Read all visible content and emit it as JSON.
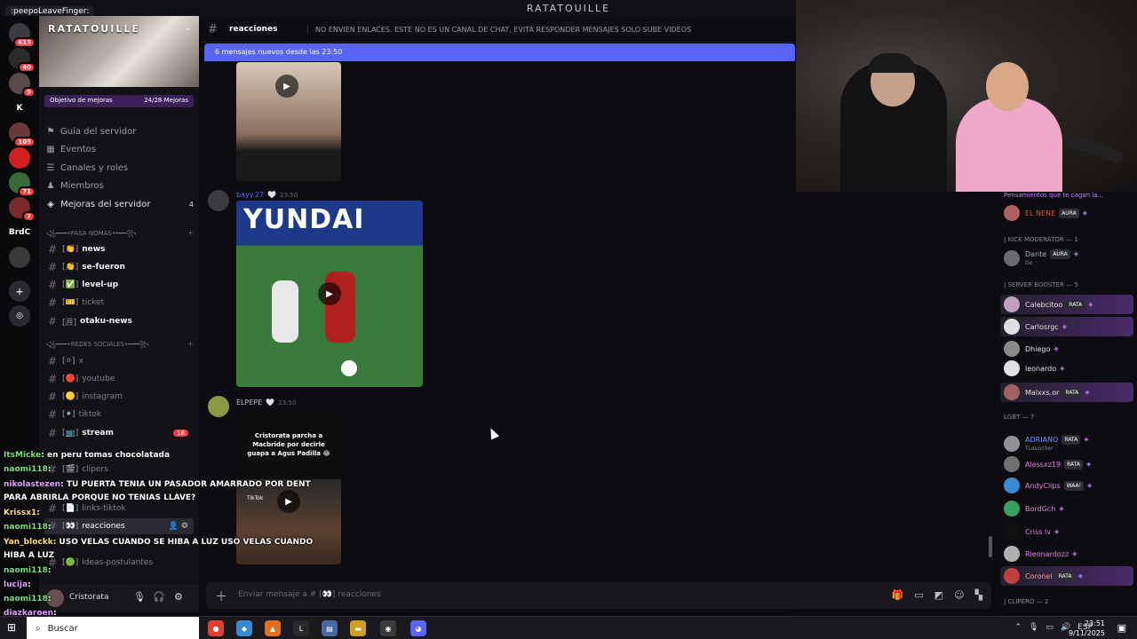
{
  "window": {
    "title": "RATATOUILLE",
    "tag": ":peepoLeaveFinger:"
  },
  "rail": {
    "servers": [
      {
        "label": "",
        "badge": "615",
        "color": "#3a3a40"
      },
      {
        "label": "",
        "badge": "40",
        "color": "#2a2a2a"
      },
      {
        "label": "",
        "badge": "9",
        "color": "#5a4a4a"
      },
      {
        "label": "K",
        "badge": "",
        "color": "#0a0a0d"
      },
      {
        "label": "",
        "badge": "105",
        "color": "#6a3a3a"
      },
      {
        "label": "",
        "badge": "",
        "color": "#d02020"
      },
      {
        "label": "",
        "badge": "71",
        "color": "#3a6a3a"
      },
      {
        "label": "",
        "badge": "7",
        "color": "#7a2a2a"
      },
      {
        "label": "BrdC",
        "badge": "",
        "color": "#0a0a0d"
      },
      {
        "label": "",
        "badge": "",
        "color": "#3a3a3a"
      }
    ],
    "add_icon": "plus-icon",
    "discover_icon": "compass-icon"
  },
  "server": {
    "name": "RATATOUILLE",
    "goal_label": "Objetivo de mejoras",
    "goal_value": "24/28 Mejoras",
    "nav": [
      {
        "label": "Guía del servidor",
        "icon": "signpost-icon",
        "glyph": "⚑"
      },
      {
        "label": "Eventos",
        "icon": "calendar-icon",
        "glyph": "▦"
      },
      {
        "label": "Canales y roles",
        "icon": "list-icon",
        "glyph": "☰"
      },
      {
        "label": "Miembros",
        "icon": "members-icon",
        "glyph": "♟"
      },
      {
        "label": "Mejoras del servidor",
        "icon": "boost-icon",
        "glyph": "◈",
        "count": "4"
      }
    ],
    "categories": [
      {
        "label": "꧁━━━•PASA NOMAS•━━━꧂"
      },
      {
        "label": "꧁━━━•REDES SOCIALES•━━━꧂"
      }
    ],
    "channels": [
      {
        "emoji": "[👏]",
        "name": "news",
        "bold": true
      },
      {
        "emoji": "[👏]",
        "name": "se-fueron",
        "bold": true
      },
      {
        "emoji": "[✅]",
        "name": "level-up",
        "bold": true
      },
      {
        "emoji": "[🎫]",
        "name": "ticket",
        "bold": false
      },
      {
        "emoji": "[🈷]",
        "name": "otaku-news",
        "bold": true
      },
      {
        "emoji": "[⚪]",
        "name": "x",
        "bold": false
      },
      {
        "emoji": "[🔴]",
        "name": "youtube",
        "bold": false
      },
      {
        "emoji": "[🟡]",
        "name": "instagram",
        "bold": false
      },
      {
        "emoji": "[⚫]",
        "name": "tiktok",
        "bold": false
      },
      {
        "emoji": "[📺]",
        "name": "stream",
        "bold": true,
        "pill": "16"
      },
      {
        "emoji": "[🎬]",
        "name": "clipers",
        "bold": false
      },
      {
        "emoji": "[📄]",
        "name": "links-tiktok",
        "bold": false
      },
      {
        "emoji": "[👀]",
        "name": "reacciones",
        "bold": false,
        "active": true
      },
      {
        "emoji": "[🟢]",
        "name": "ideas-postulantes",
        "bold": false
      }
    ],
    "user": {
      "name": "Cristorata"
    }
  },
  "streamchat": [
    {
      "user": "ItsMicke",
      "text": ": en peru tomas chocolatada",
      "cls": "g"
    },
    {
      "user": "naomi118",
      "text": ":",
      "cls": "g"
    },
    {
      "user": "nikolastezen",
      "text": ": TU PUERTA TENIA UN PASADOR AMARRADO POR DENT",
      "cls": "p"
    },
    {
      "user": "",
      "text": "PARA ABRIRLA PORQUE NO TENIAS LLAVE?",
      "cls": ""
    },
    {
      "user": "Krissx1",
      "text": ":",
      "cls": "y"
    },
    {
      "user": "naomi118",
      "text": ":",
      "cls": "g"
    },
    {
      "user": "Yan_blockk",
      "text": ": USO VELAS CUANDO SE HIBA A LUZ USO VELAS CUANDO",
      "cls": "y"
    },
    {
      "user": "",
      "text": "HIBA A LUZ",
      "cls": ""
    },
    {
      "user": "naomi118",
      "text": ":",
      "cls": "g"
    },
    {
      "user": "lucija",
      "text": ":",
      "cls": "p"
    },
    {
      "user": "naomi118",
      "text": ":",
      "cls": "g"
    },
    {
      "user": "diazkaroen",
      "text": ":",
      "cls": "p"
    }
  ],
  "channel": {
    "name": "reacciones",
    "topic": "NO ENVIEN ENLACES. ESTE NO ES UN CANAL DE CHAT, EVITA RESPONDER MENSAJES SOLO SUBE VIDEOS",
    "new_messages": "6 mensajes nuevos desde las 23:50"
  },
  "messages": [
    {
      "author": "bayy.27",
      "time": "23:50",
      "media_text": "YUNDAI"
    },
    {
      "author": "ELPEPE",
      "time": "23:50",
      "media_text": "Cristorata parcha a Macbride por decirle guapa a Agus Padilla 😂",
      "media_sub": "TikTok"
    }
  ],
  "composer": {
    "placeholder": "Enviar mensaje a #  [👀]  reacciones"
  },
  "members": {
    "top_status": "Pensamientos que te cagan la...",
    "groups": [
      {
        "label": "| KICK MODERATOR — 1"
      },
      {
        "label": "| SERVER BOOSTER — 5"
      },
      {
        "label": "LGBT — 7"
      },
      {
        "label": "| CLIPERO — 2"
      }
    ],
    "list": [
      {
        "name": "EL NENE",
        "tag": "AURA",
        "color": "#e05050",
        "boost": false
      },
      {
        "name": "Dante",
        "tag": "AURA",
        "sub": "Go",
        "color": "#9ab0c0",
        "boost": false
      },
      {
        "name": "Calebcitoo",
        "tag": "RATA",
        "color": "#e0e0e0",
        "boost": true
      },
      {
        "name": "Carlosrgc",
        "tag": "",
        "color": "#e0e0e0",
        "boost": true
      },
      {
        "name": "Dhiego",
        "tag": "",
        "color": "#e0e0e0",
        "boost": false
      },
      {
        "name": "leonardo",
        "tag": "",
        "color": "#e0e0e0",
        "boost": false
      },
      {
        "name": "Malxxs.or",
        "tag": "RATA",
        "color": "#e0e0e0",
        "boost": true
      },
      {
        "name": "ADRIANO",
        "tag": "RATA",
        "sub": "TLauncher",
        "color": "#8090ff",
        "boost": false
      },
      {
        "name": "Alessxz19",
        "tag": "RATA",
        "color": "#e080e0",
        "boost": false
      },
      {
        "name": "AndyClips",
        "tag": "WAA!",
        "color": "#e080e0",
        "boost": false
      },
      {
        "name": "BordGch",
        "tag": "",
        "color": "#e080e0",
        "boost": false
      },
      {
        "name": "Criss lv",
        "tag": "",
        "color": "#e080e0",
        "boost": false
      },
      {
        "name": "Rleonardozz",
        "tag": "",
        "color": "#e080e0",
        "boost": false
      },
      {
        "name": "Coronel",
        "tag": "RATA",
        "color": "#ff9090",
        "boost": true
      }
    ]
  },
  "taskbar": {
    "search": "Buscar",
    "lang": "ESP",
    "time": "23:51",
    "date": "9/11/2025"
  }
}
